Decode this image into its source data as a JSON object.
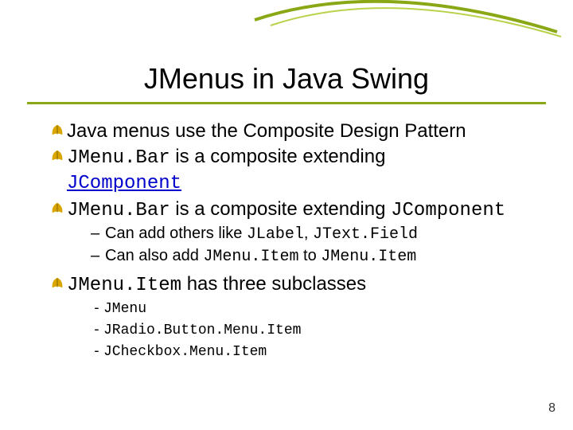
{
  "title": "JMenus in Java Swing",
  "bullets": {
    "b1": "Java menus use the Composite Design Pattern",
    "b2_pre": "JMenu.Bar",
    "b2_post": " is a composite extending ",
    "b2_link": "JComponent",
    "b3_pre": "JMenu.Bar",
    "b3_mid1": " is a composite extending ",
    "b3_code2": "JComponent",
    "b3_sub1_a": "Can add others like ",
    "b3_sub1_c1": "JLabel",
    "b3_sub1_b": ", ",
    "b3_sub1_c2": "JText.Field",
    "b3_sub2_a": "Can also add ",
    "b3_sub2_c1": "JMenu.Item",
    "b3_sub2_b": " to ",
    "b3_sub2_c2": "JMenu.Item",
    "b4_pre": "JMenu.Item",
    "b4_post": " has three subclasses",
    "b4_s1": "JMenu",
    "b4_s2": "JRadio.Button.Menu.Item",
    "b4_s3": "JCheckbox.Menu.Item"
  },
  "page_number": "8"
}
